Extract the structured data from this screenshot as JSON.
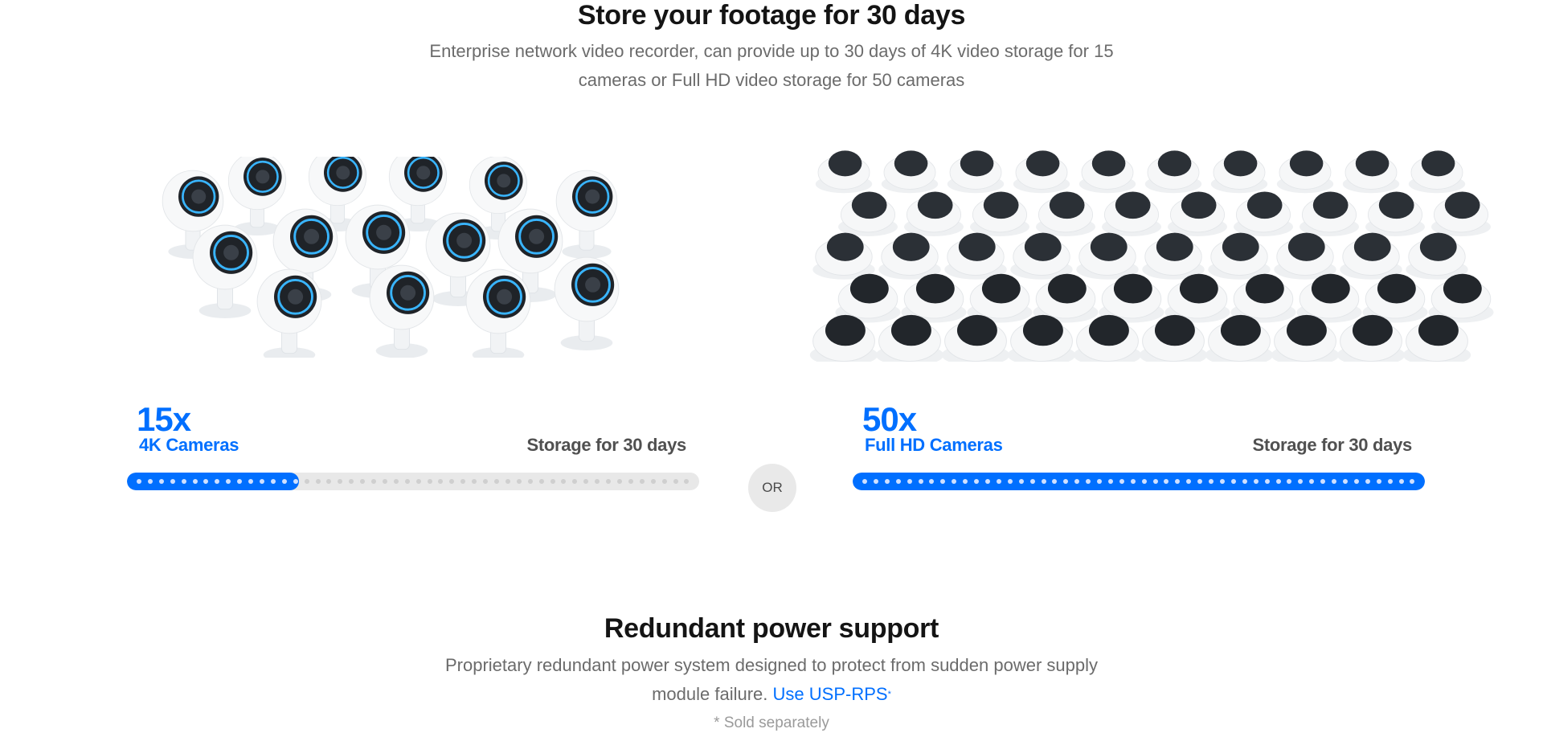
{
  "footage": {
    "title": "Store your footage for 30 days",
    "subtitle": "Enterprise network video recorder, can provide up to 30 days of 4K video storage for 15 cameras or Full HD video storage for 50 cameras"
  },
  "options": [
    {
      "count": "15x",
      "label": "4K Cameras",
      "storage": "Storage for 30 days",
      "progress_fraction": 0.3,
      "accent": "#006fff"
    },
    {
      "count": "50x",
      "label": "Full HD Cameras",
      "storage": "Storage for 30 days",
      "progress_fraction": 1.0,
      "accent": "#006fff"
    }
  ],
  "or_label": "OR",
  "power": {
    "title": "Redundant power support",
    "subtitle_text": "Proprietary redundant power system designed to protect from sudden power supply module failure.",
    "link_text": "Use USP-RPS",
    "link_marker": "*",
    "note": "* Sold separately"
  },
  "icons": {
    "left_illustration": "bullet-camera-cluster-icon",
    "right_illustration": "dome-camera-cluster-icon"
  },
  "colors": {
    "accent": "#006fff",
    "text": "#141414",
    "muted": "#6b6b6b",
    "track": "#e8e8e8"
  }
}
